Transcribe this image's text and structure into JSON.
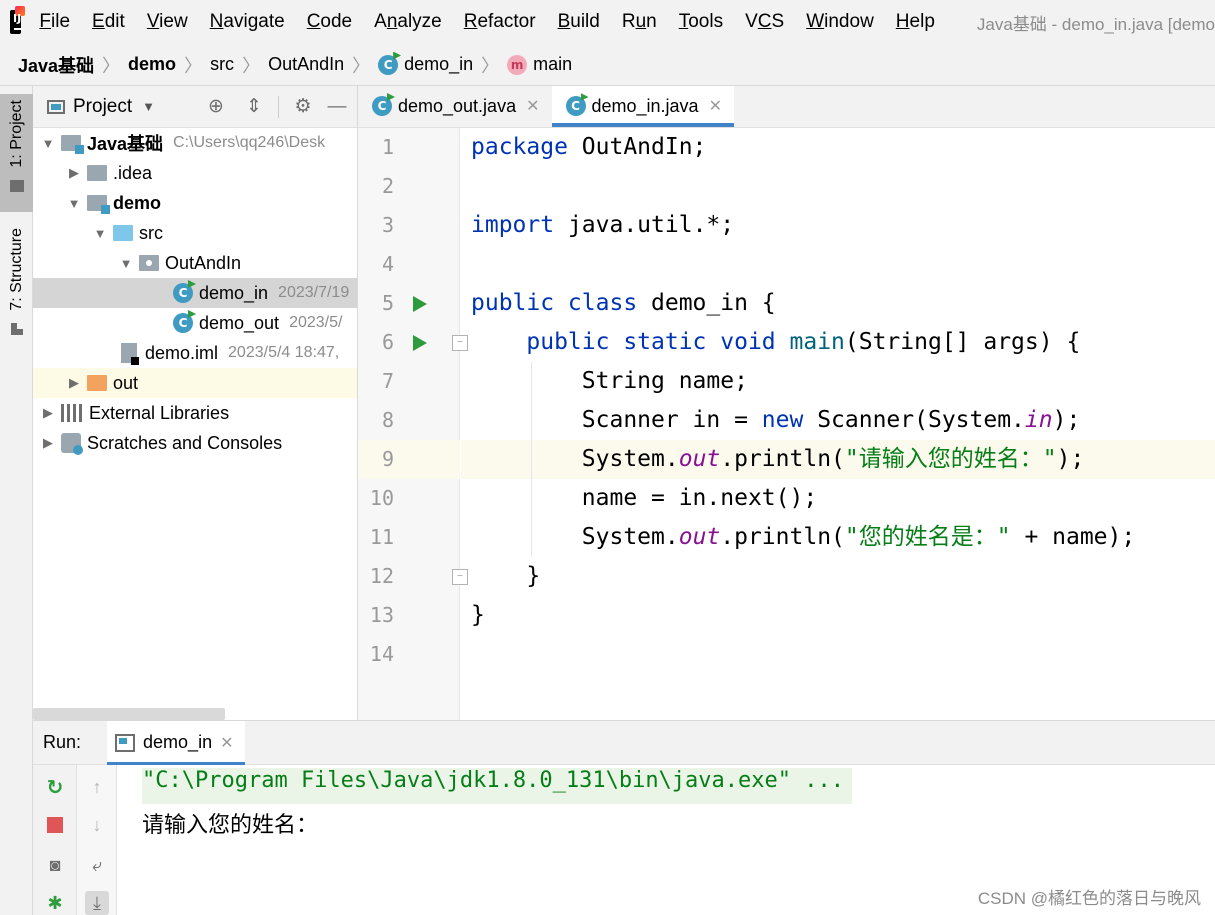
{
  "window": {
    "title": "Java基础 - demo_in.java [demo"
  },
  "menu": [
    {
      "underline": "F",
      "rest": "ile"
    },
    {
      "underline": "E",
      "rest": "dit"
    },
    {
      "underline": "V",
      "rest": "iew"
    },
    {
      "underline": "N",
      "rest": "avigate"
    },
    {
      "underline": "C",
      "rest": "ode"
    },
    {
      "underline": "",
      "rest": "Analyze",
      "underline_index": 1
    },
    {
      "underline": "R",
      "rest": "efactor"
    },
    {
      "underline": "B",
      "rest": "uild"
    },
    {
      "underline": "",
      "rest": "Run",
      "underline_index": 1
    },
    {
      "underline": "T",
      "rest": "ools"
    },
    {
      "underline": "",
      "rest": "VCS",
      "underline_index": 1
    },
    {
      "underline": "W",
      "rest": "indow"
    },
    {
      "underline": "H",
      "rest": "elp"
    }
  ],
  "breadcrumb": {
    "project": "Java基础",
    "module": "demo",
    "src": "src",
    "package": "OutAndIn",
    "class": "demo_in",
    "method": "main",
    "class_icon": "class-icon",
    "method_icon": "method-icon",
    "method_icon_letter": "m",
    "class_icon_letter": "C"
  },
  "tool_strip": {
    "project_tab": "1: Project",
    "structure_tab": "7: Structure"
  },
  "project_panel": {
    "title": "Project",
    "tree": [
      {
        "label": "Java基础",
        "meta": "C:\\Users\\qq246\\Desk",
        "bold": true,
        "expanded": true,
        "icon": "module-folder-icon"
      },
      {
        "label": ".idea",
        "meta": "",
        "expanded": false,
        "icon": "folder-icon"
      },
      {
        "label": "demo",
        "meta": "",
        "bold": true,
        "expanded": true,
        "icon": "module-folder-icon"
      },
      {
        "label": "src",
        "meta": "",
        "expanded": true,
        "icon": "source-folder-icon"
      },
      {
        "label": "OutAndIn",
        "meta": "",
        "expanded": true,
        "icon": "package-icon"
      },
      {
        "label": "demo_in",
        "meta": "2023/7/19",
        "selected": true,
        "icon": "class-icon"
      },
      {
        "label": "demo_out",
        "meta": "2023/5/",
        "icon": "class-icon"
      },
      {
        "label": "demo.iml",
        "meta": "2023/5/4 18:47,",
        "icon": "iml-file-icon"
      },
      {
        "label": "out",
        "meta": "",
        "expanded": false,
        "icon": "excluded-folder-icon",
        "highlight": true
      },
      {
        "label": "External Libraries",
        "meta": "",
        "expanded": false,
        "icon": "libraries-icon"
      },
      {
        "label": "Scratches and Consoles",
        "meta": "",
        "expanded": false,
        "icon": "scratches-icon"
      }
    ]
  },
  "editor": {
    "tabs": [
      {
        "label": "demo_out.java",
        "active": false
      },
      {
        "label": "demo_in.java",
        "active": true
      }
    ],
    "line_numbers": [
      "1",
      "2",
      "3",
      "4",
      "5",
      "6",
      "7",
      "8",
      "9",
      "10",
      "11",
      "12",
      "13",
      "14"
    ],
    "run_markers": [
      5,
      6
    ],
    "current_line": 9,
    "code": {
      "l1": {
        "kw": "package",
        "rest": " OutAndIn;"
      },
      "l3": {
        "kw": "import",
        "rest": " java.util.*;"
      },
      "l5": {
        "kw": "public class",
        "rest": " demo_in {"
      },
      "l6": {
        "indent": "    ",
        "kw": "public static void",
        "mth": "main",
        "rest": "(String[] args) {"
      },
      "l7": {
        "indent": "        ",
        "rest": "String name;"
      },
      "l8": {
        "indent": "        ",
        "pre": "Scanner in = ",
        "kw": "new",
        "mid": " Scanner(System.",
        "fld": "in",
        "rest": ");"
      },
      "l9": {
        "indent": "        ",
        "pre": "System.",
        "fld": "out",
        "mid": ".println(",
        "str": "\"请输入您的姓名：\"",
        "rest": ");"
      },
      "l10": {
        "indent": "        ",
        "rest": "name = in.next();"
      },
      "l11": {
        "indent": "        ",
        "pre": "System.",
        "fld": "out",
        "mid": ".println(",
        "str": "\"您的姓名是：\"",
        "rest": " + name);"
      },
      "l12": {
        "indent": "    ",
        "rest": "}"
      },
      "l13": {
        "rest": "}"
      }
    }
  },
  "run_panel": {
    "title": "Run:",
    "tab_label": "demo_in",
    "console": [
      {
        "text": "\"C:\\Program Files\\Java\\jdk1.8.0_131\\bin\\java.exe\" ...",
        "kind": "cmd"
      },
      {
        "text": "请输入您的姓名：",
        "kind": "out"
      }
    ]
  },
  "watermark": "CSDN @橘红色的落日与晚风"
}
